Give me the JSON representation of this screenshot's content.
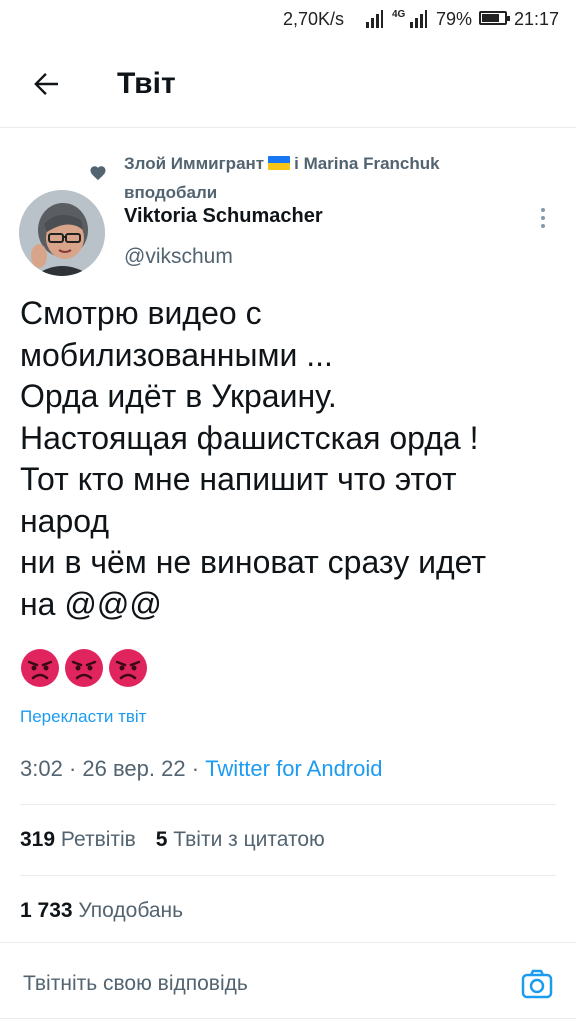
{
  "status_bar": {
    "network_speed": "2,70K/s",
    "network_type": "4G",
    "battery_percent": "79%",
    "battery_level": 0.79,
    "time": "21:17"
  },
  "header": {
    "back_icon": "arrow-left-icon",
    "title": "Твіт"
  },
  "social_context": {
    "icon": "heart-icon",
    "user1": "Злой Иммигрант",
    "flag": "ukraine-flag",
    "connector": "і Marina Franchuk",
    "action": "вподобали"
  },
  "author": {
    "name": "Viktoria Schumacher",
    "handle": "@vikschum",
    "more_icon": "more-vertical-icon"
  },
  "tweet": {
    "text": "Смотрю видео с\nмобилизованными ...\nОрда идёт в Украину.\nНастоящая фашистская орда !\nТот кто мне напишит что этот\nнарод\nни в чём не виноват сразу идет\nна @@@",
    "emojis": [
      "angry-face-emoji",
      "angry-face-emoji",
      "angry-face-emoji"
    ],
    "translate": "Перекласти твіт",
    "time": "3:02",
    "date": "26 вер. 22",
    "separator": "·",
    "source": "Twitter for Android"
  },
  "stats": {
    "retweets_count": "319",
    "retweets_label": "Ретвітів",
    "quotes_count": "5",
    "quotes_label": "Твіти з цитатою",
    "likes_count": "1 733",
    "likes_label": "Уподобань"
  },
  "reply": {
    "placeholder": "Твітніть свою відповідь",
    "camera_icon": "camera-icon"
  },
  "colors": {
    "accent": "#1d9bf0",
    "text_primary": "#0f1419",
    "text_secondary": "#536471",
    "divider": "#e6ecf0",
    "angry_emoji": "#e0245e"
  }
}
